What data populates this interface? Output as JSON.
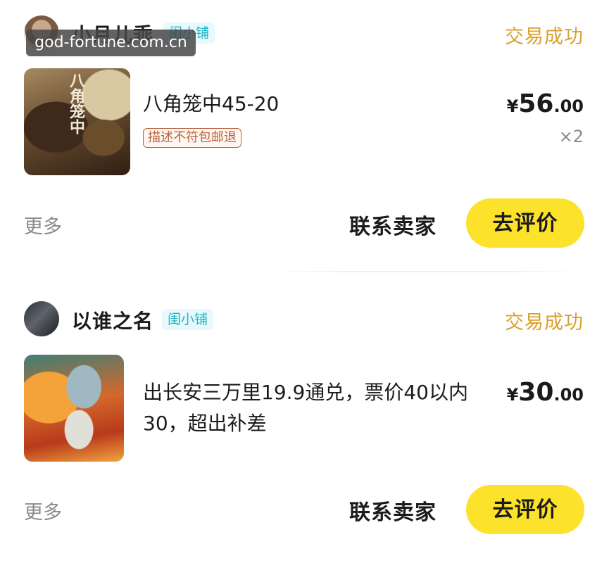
{
  "watermark": "god-fortune.com.cn",
  "colors": {
    "status": "#d9a12e",
    "badge": "#19b6c9",
    "review_button": "#fce22a",
    "tag": "#b8633e"
  },
  "orders": [
    {
      "seller_name": "小月儿乖",
      "shop_badge": "闺小铺",
      "status": "交易成功",
      "thumbnail_text": "八角笼中",
      "item_title": "八角笼中45-20",
      "tag": "描述不符包邮退",
      "price_symbol": "¥",
      "price_int": "56",
      "price_dec": ".00",
      "quantity": "×2",
      "more_label": "更多",
      "contact_label": "联系卖家",
      "review_label": "去评价"
    },
    {
      "seller_name": "以谁之名",
      "shop_badge": "闺小铺",
      "status": "交易成功",
      "item_title": "出长安三万里19.9通兑，票价40以内30，超出补差",
      "price_symbol": "¥",
      "price_int": "30",
      "price_dec": ".00",
      "more_label": "更多",
      "contact_label": "联系卖家",
      "review_label": "去评价"
    }
  ]
}
